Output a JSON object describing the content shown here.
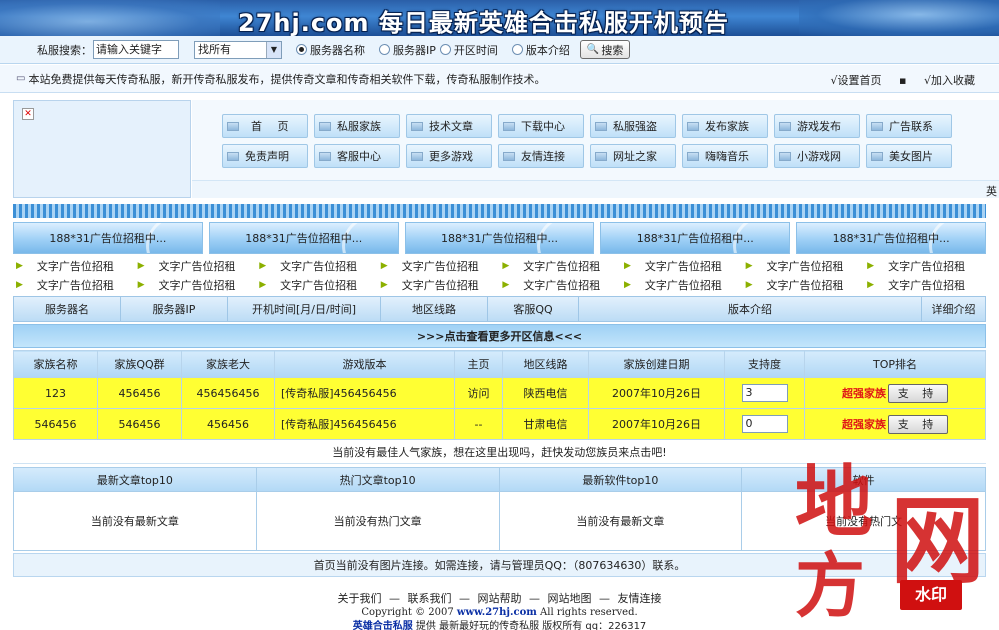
{
  "banner": {
    "title": "27hj.com 每日最新英雄合击私服开机预告"
  },
  "search": {
    "label": "私服搜索：",
    "keyword_value": "请输入关键字",
    "scope_value": "找所有",
    "radios": [
      {
        "label": "服务器名称",
        "checked": true
      },
      {
        "label": "服务器IP",
        "checked": false
      },
      {
        "label": "开区时间",
        "checked": false
      },
      {
        "label": "版本介绍",
        "checked": false
      }
    ],
    "button_label": "搜索"
  },
  "notice": {
    "text": "本站免费提供每天传奇私服，新开传奇私服发布，提供传奇文章和传奇相关软件下载，传奇私服制作技术。",
    "set_home": "设置首页",
    "favorite": "加入收藏"
  },
  "nav": {
    "items": [
      {
        "label": "首 页"
      },
      {
        "label": "私服家族"
      },
      {
        "label": "技术文章"
      },
      {
        "label": "下载中心"
      },
      {
        "label": "私服强盗"
      },
      {
        "label": "发布家族"
      },
      {
        "label": "游戏发布"
      },
      {
        "label": "广告联系"
      },
      {
        "label": "免责声明"
      },
      {
        "label": "客服中心"
      },
      {
        "label": "更多游戏"
      },
      {
        "label": "友情连接"
      },
      {
        "label": "网址之家"
      },
      {
        "label": "嗨嗨音乐"
      },
      {
        "label": "小游戏网"
      },
      {
        "label": "美女图片"
      }
    ],
    "marquee": "英"
  },
  "ads": {
    "banners": [
      "188*31广告位招租中...",
      "188*31广告位招租中...",
      "188*31广告位招租中...",
      "188*31广告位招租中...",
      "188*31广告位招租中..."
    ],
    "text_ads": [
      "文字广告位招租",
      "文字广告位招租",
      "文字广告位招租",
      "文字广告位招租",
      "文字广告位招租",
      "文字广告位招租",
      "文字广告位招租",
      "文字广告位招租",
      "文字广告位招租",
      "文字广告位招租",
      "文字广告位招租",
      "文字广告位招租",
      "文字广告位招租",
      "文字广告位招租",
      "文字广告位招租",
      "文字广告位招租"
    ]
  },
  "server_table": {
    "headers": [
      "服务器名",
      "服务器IP",
      "开机时间[月/日/时间]",
      "地区线路",
      "客服QQ",
      "版本介绍",
      "详细介绍"
    ]
  },
  "more_link": ">>>点击查看更多开区信息<<<",
  "family_table": {
    "headers": [
      "家族名称",
      "家族QQ群",
      "家族老大",
      "游戏版本",
      "主页",
      "地区线路",
      "家族创建日期",
      "支持度",
      "TOP排名"
    ],
    "rows": [
      {
        "name": "123",
        "qq_group": "456456",
        "leader": "456456456",
        "version": "[传奇私服]456456456",
        "home": "访问",
        "region": "陕西电信",
        "created": "2007年10月26日",
        "support": "3",
        "rank": "超强家族",
        "support_button": "支 持"
      },
      {
        "name": "546456",
        "qq_group": "546456",
        "leader": "456456",
        "version": "[传奇私服]456456456",
        "home": "--",
        "region": "甘肃电信",
        "created": "2007年10月26日",
        "support": "0",
        "rank": "超强家族",
        "support_button": "支 持"
      }
    ],
    "note": "当前没有最佳人气家族，想在这里出现吗，赶快发动您族员来点击吧!"
  },
  "lists": [
    {
      "title": "最新文章top10",
      "body": "当前没有最新文章"
    },
    {
      "title": "热门文章top10",
      "body": "当前没有热门文章"
    },
    {
      "title": "最新软件top10",
      "body": "当前没有最新文章"
    },
    {
      "title": "软件",
      "body": "当前没有热门文"
    }
  ],
  "picnote": "首页当前没有图片连接。如需连接，请与管理员QQ：（807634630）联系。",
  "footer": {
    "links": [
      "关于我们",
      "联系我们",
      "网站帮助",
      "网站地图",
      "友情连接"
    ],
    "separator": "—",
    "copyright_prefix": "Copyright © 2007",
    "copyright_url": "www.27hj.com",
    "copyright_suffix": "All rights reserved.",
    "row3_strong": "英雄合击私服",
    "row3_text": "提供 最新最好玩的传奇私服 版权所有 qq：226317"
  },
  "watermark": {
    "chars": [
      "地",
      "方",
      "网"
    ],
    "stamp": "水印"
  },
  "colors": {
    "banner": "#2a5fa8",
    "family_row_bg": "#ffff33",
    "rank_red": "#e01616",
    "footer_link_blue": "#0a2fa5"
  }
}
